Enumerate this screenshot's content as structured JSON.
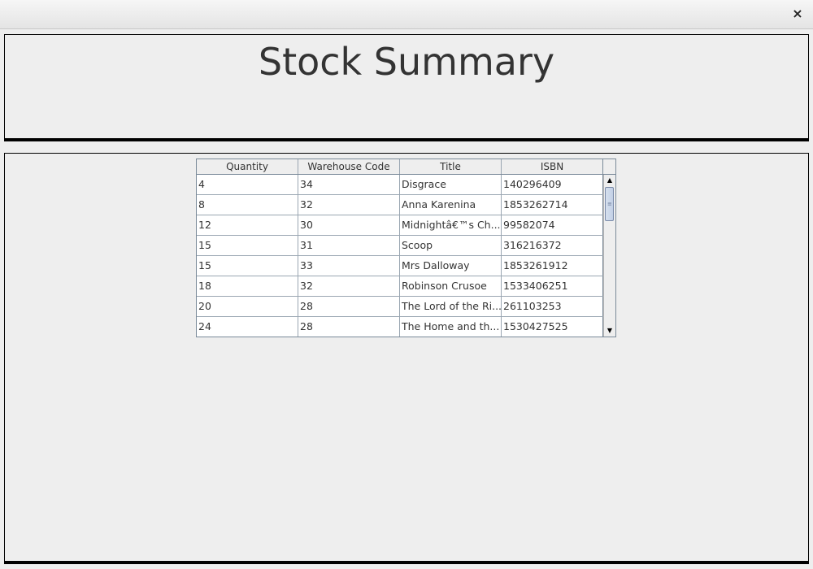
{
  "window": {
    "close_glyph": "×"
  },
  "header": {
    "title": "Stock Summary"
  },
  "table": {
    "columns": [
      "Quantity",
      "Warehouse Code",
      "Title",
      "ISBN"
    ],
    "rows": [
      [
        "4",
        "34",
        "Disgrace",
        "140296409"
      ],
      [
        "8",
        "32",
        "Anna Karenina",
        "1853262714"
      ],
      [
        "12",
        "30",
        "Midnightâ€™s Ch...",
        "99582074"
      ],
      [
        "15",
        "31",
        "Scoop",
        "316216372"
      ],
      [
        "15",
        "33",
        "Mrs Dalloway",
        "1853261912"
      ],
      [
        "18",
        "32",
        "Robinson Crusoe",
        "1533406251"
      ],
      [
        "20",
        "28",
        "The Lord of the Ri...",
        "261103253"
      ],
      [
        "24",
        "28",
        "The Home and th...",
        "1530427525"
      ]
    ]
  },
  "scrollbar": {
    "up_glyph": "▲",
    "down_glyph": "▼",
    "grip_glyph": "≡"
  }
}
